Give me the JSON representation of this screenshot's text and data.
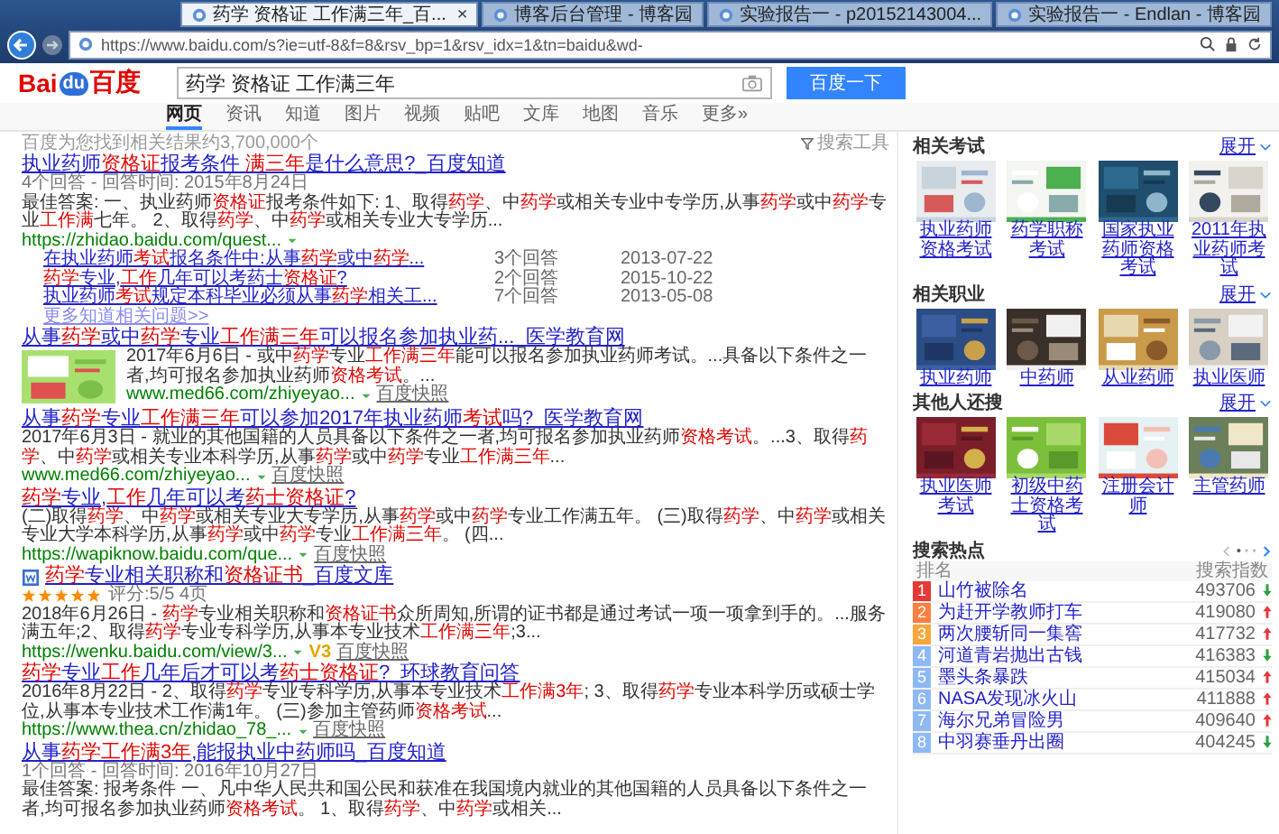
{
  "browser": {
    "url": "https://www.baidu.com/s?ie=utf-8&f=8&rsv_bp=1&rsv_idx=1&tn=baidu&wd-",
    "tabs": [
      {
        "title": "药学 资格证 工作满三年_百...",
        "selected": true,
        "close": "×"
      },
      {
        "title": "博客后台管理 - 博客园",
        "selected": false
      },
      {
        "title": "实验报告一 - p20152143004...",
        "selected": false
      },
      {
        "title": "实验报告一 - Endlan - 博客园",
        "selected": false
      }
    ]
  },
  "header": {
    "logo": [
      "Bai",
      "du",
      "百度"
    ],
    "query": "药学 资格证 工作满三年",
    "button": "百度一下"
  },
  "nav": [
    {
      "label": "网页",
      "selected": true
    },
    {
      "label": "资讯",
      "selected": false
    },
    {
      "label": "知道",
      "selected": false
    },
    {
      "label": "图片",
      "selected": false
    },
    {
      "label": "视频",
      "selected": false
    },
    {
      "label": "贴吧",
      "selected": false
    },
    {
      "label": "文库",
      "selected": false
    },
    {
      "label": "地图",
      "selected": false
    },
    {
      "label": "音乐",
      "selected": false
    },
    {
      "label": "更多»",
      "selected": false
    }
  ],
  "result_count": "百度为您找到相关结果约3,700,000个",
  "tools": "搜索工具",
  "results": [
    {
      "title": "执业药师**资格证**报考条件 **满三年**是什么意思?_百度知道",
      "meta": "4个回答 - 回答时间: 2015年8月24日",
      "snippet": "最佳答案: 一、执业药师**资格证**报考条件如下: 1、取得**药学**、中**药学**或相关专业中专学历,从事**药学**或中**药学**专业**工作满**七年。 2、取得**药学**、中**药学**或相关专业大专学历...",
      "url": "https://zhidao.baidu.com/quest...",
      "questions": [
        {
          "title": "在执业药师**考试**报名条件中:从事**药学**或中**药学**...",
          "answers": "3个回答",
          "date": "2013-07-22"
        },
        {
          "title": "**药学**专业,**工作**几年可以考药士**资格证**?",
          "answers": "2个回答",
          "date": "2015-10-22"
        },
        {
          "title": "执业药师**考试**规定本科毕业必须从事**药学**相关工...",
          "answers": "7个回答",
          "date": "2013-05-08"
        }
      ],
      "more": "更多知道相关问题>>"
    },
    {
      "title": "从事**药学**或中**药学**专业**工作满三年**可以报名参加执业药..._医学教育网",
      "snippet": "2017年6月6日 - 或中**药学**专业**工作满三年**能可以报名参加执业药师考试。...具备以下条件之一者,均可报名参加执业药师**资格考试**。...",
      "url": "www.med66.com/zhiyeyao...",
      "snapshot": "百度快照"
    },
    {
      "title": "从事**药学**专业**工作满三年**可以参加2017年执业药师**考试**吗?_医学教育网",
      "snippet": "2017年6月3日 - 就业的其他国籍的人员具备以下条件之一者,均可报名参加执业药师**资格考试**。...3、取得**药学**、中**药学**或相关专业本科学历,从事**药学**或中**药学**专业**工作满三年**...",
      "url": "www.med66.com/zhiyeyao...",
      "snapshot": "百度快照"
    },
    {
      "title": "**药学**专业,**工作**几年可以考**药士资格证**?",
      "snippet": "(二)取得**药学**、中**药学**或相关专业大专学历,从事**药学**或中**药学**专业工作满五年。 (三)取得**药学**、中**药学**或相关专业大学本科学历,从事**药学**或中**药学**专业**工作满三年**。 (四...",
      "url": "https://wapiknow.baidu.com/que...",
      "snapshot": "百度快照"
    },
    {
      "title": "**药学**专业相关职称和**资格证书**_百度文库",
      "doc": true,
      "stars": 5,
      "rating": "评分:5/5 4页",
      "snippet": "2018年6月26日 - **药学**专业相关职称和**资格证书**众所周知,所谓的证书都是通过考试一项一项拿到手的。...服务满五年;2、取得**药学**专业专科学历,从事本专业技术**工作满三年**;3...",
      "url": "https://wenku.baidu.com/view/3...",
      "badge": "V3",
      "snapshot": "百度快照"
    },
    {
      "title": "**药学**专业**工作**几年后才可以考**药士资格证**?_环球教育问答",
      "snippet": "2016年8月22日 - 2、取得**药学**专业专科学历,从事本专业技术**工作满3年**; 3、取得**药学**专业本科学历或硕士学位,从事本专业技术工作满1年。 (三)参加主管药师**资格考试**...",
      "url": "https://www.thea.cn/zhidao_78_...",
      "snapshot": "百度快照"
    },
    {
      "title": "从事**药学工作满3年**,能报执业中药师吗_百度知道",
      "meta": "1个回答 - 回答时间: 2016年10月27日",
      "snippet": "最佳答案: 报考条件 一、凡中华人民共和国公民和获准在我国境内就业的其他国籍的人员具备以下条件之一者,均可报名参加执业药师**资格考试**。 1、取得**药学**、中**药学**或相关..."
    }
  ],
  "sidebar": {
    "sections": [
      {
        "title": "相关考试",
        "expand": "展开",
        "items": [
          {
            "label": "执业药师资格考试"
          },
          {
            "label": "药学职称考试"
          },
          {
            "label": "国家执业药师资格考试"
          },
          {
            "label": "2011年执业药师考试"
          }
        ]
      },
      {
        "title": "相关职业",
        "expand": "展开",
        "items": [
          {
            "label": "执业药师"
          },
          {
            "label": "中药师"
          },
          {
            "label": "从业药师"
          },
          {
            "label": "执业医师"
          }
        ]
      },
      {
        "title": "其他人还搜",
        "expand": "展开",
        "items": [
          {
            "label": "执业医师考试"
          },
          {
            "label": "初级中药士资格考试"
          },
          {
            "label": "注册会计师"
          },
          {
            "label": "主管药师"
          }
        ]
      }
    ],
    "hot": {
      "title": "搜索热点",
      "col_rank": "排名",
      "col_index": "搜索指数",
      "items": [
        {
          "rank": "1",
          "title": "山竹被除名",
          "index": "493706",
          "rising": false,
          "color": "#e53935"
        },
        {
          "rank": "2",
          "title": "为赶开学教师打车",
          "index": "419080",
          "rising": true,
          "color": "#ff7f3f"
        },
        {
          "rank": "3",
          "title": "两次腰斩同一集窖",
          "index": "417732",
          "rising": true,
          "color": "#f7a73b"
        },
        {
          "rank": "4",
          "title": "河道青岩抛出古钱",
          "index": "416383",
          "rising": false,
          "color": "#8eb9f5"
        },
        {
          "rank": "5",
          "title": "墨头条暴跌",
          "index": "415034",
          "rising": true,
          "color": "#8eb9f5"
        },
        {
          "rank": "6",
          "title": "NASA发现冰火山",
          "index": "411888",
          "rising": true,
          "color": "#8eb9f5"
        },
        {
          "rank": "7",
          "title": "海尔兄弟冒险男",
          "index": "409640",
          "rising": true,
          "color": "#8eb9f5"
        },
        {
          "rank": "8",
          "title": "中羽赛垂丹出圈",
          "index": "404245",
          "rising": false,
          "color": "#8eb9f5"
        }
      ]
    }
  }
}
